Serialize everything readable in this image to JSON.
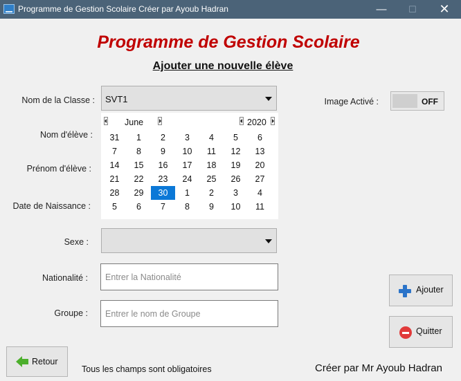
{
  "window": {
    "title": "Programme de Gestion Scolaire Créer par Ayoub Hadran",
    "minimize": "—",
    "maximize": "☐",
    "close": "✕"
  },
  "header": {
    "app_title": "Programme de Gestion Scolaire",
    "subtitle": "Ajouter une nouvelle élève"
  },
  "form": {
    "classe_label": "Nom de la Classe :",
    "classe_value": "SVT1",
    "nom_label": "Nom d'élève :",
    "prenom_label": "Prénom d'élève :",
    "naissance_label": "Date de Naissance :",
    "sexe_label": "Sexe :",
    "sexe_value": "",
    "nationalite_label": "Nationalité :",
    "nationalite_placeholder": "Entrer la Nationalité",
    "groupe_label": "Groupe :",
    "groupe_placeholder": "Entrer le nom de Groupe"
  },
  "calendar": {
    "month": "June",
    "year": "2020",
    "selected": "30",
    "weeks": [
      [
        "31",
        "1",
        "2",
        "3",
        "4",
        "5",
        "6"
      ],
      [
        "7",
        "8",
        "9",
        "10",
        "11",
        "12",
        "13"
      ],
      [
        "14",
        "15",
        "16",
        "17",
        "18",
        "19",
        "20"
      ],
      [
        "21",
        "22",
        "23",
        "24",
        "25",
        "26",
        "27"
      ],
      [
        "28",
        "29",
        "30",
        "1",
        "2",
        "3",
        "4"
      ],
      [
        "5",
        "6",
        "7",
        "8",
        "9",
        "10",
        "11"
      ]
    ]
  },
  "image_toggle": {
    "label": "Image Activé :",
    "state": "OFF"
  },
  "buttons": {
    "ajouter": "Ajouter",
    "quitter": "Quitter",
    "retour": "Retour"
  },
  "footer": {
    "note": "Tous les champs sont obligatoires",
    "credit": "Créer par Mr Ayoub Hadran"
  },
  "colors": {
    "title_red": "#c00000",
    "titlebar": "#4b6378",
    "calendar_selected": "#0b78d7"
  }
}
